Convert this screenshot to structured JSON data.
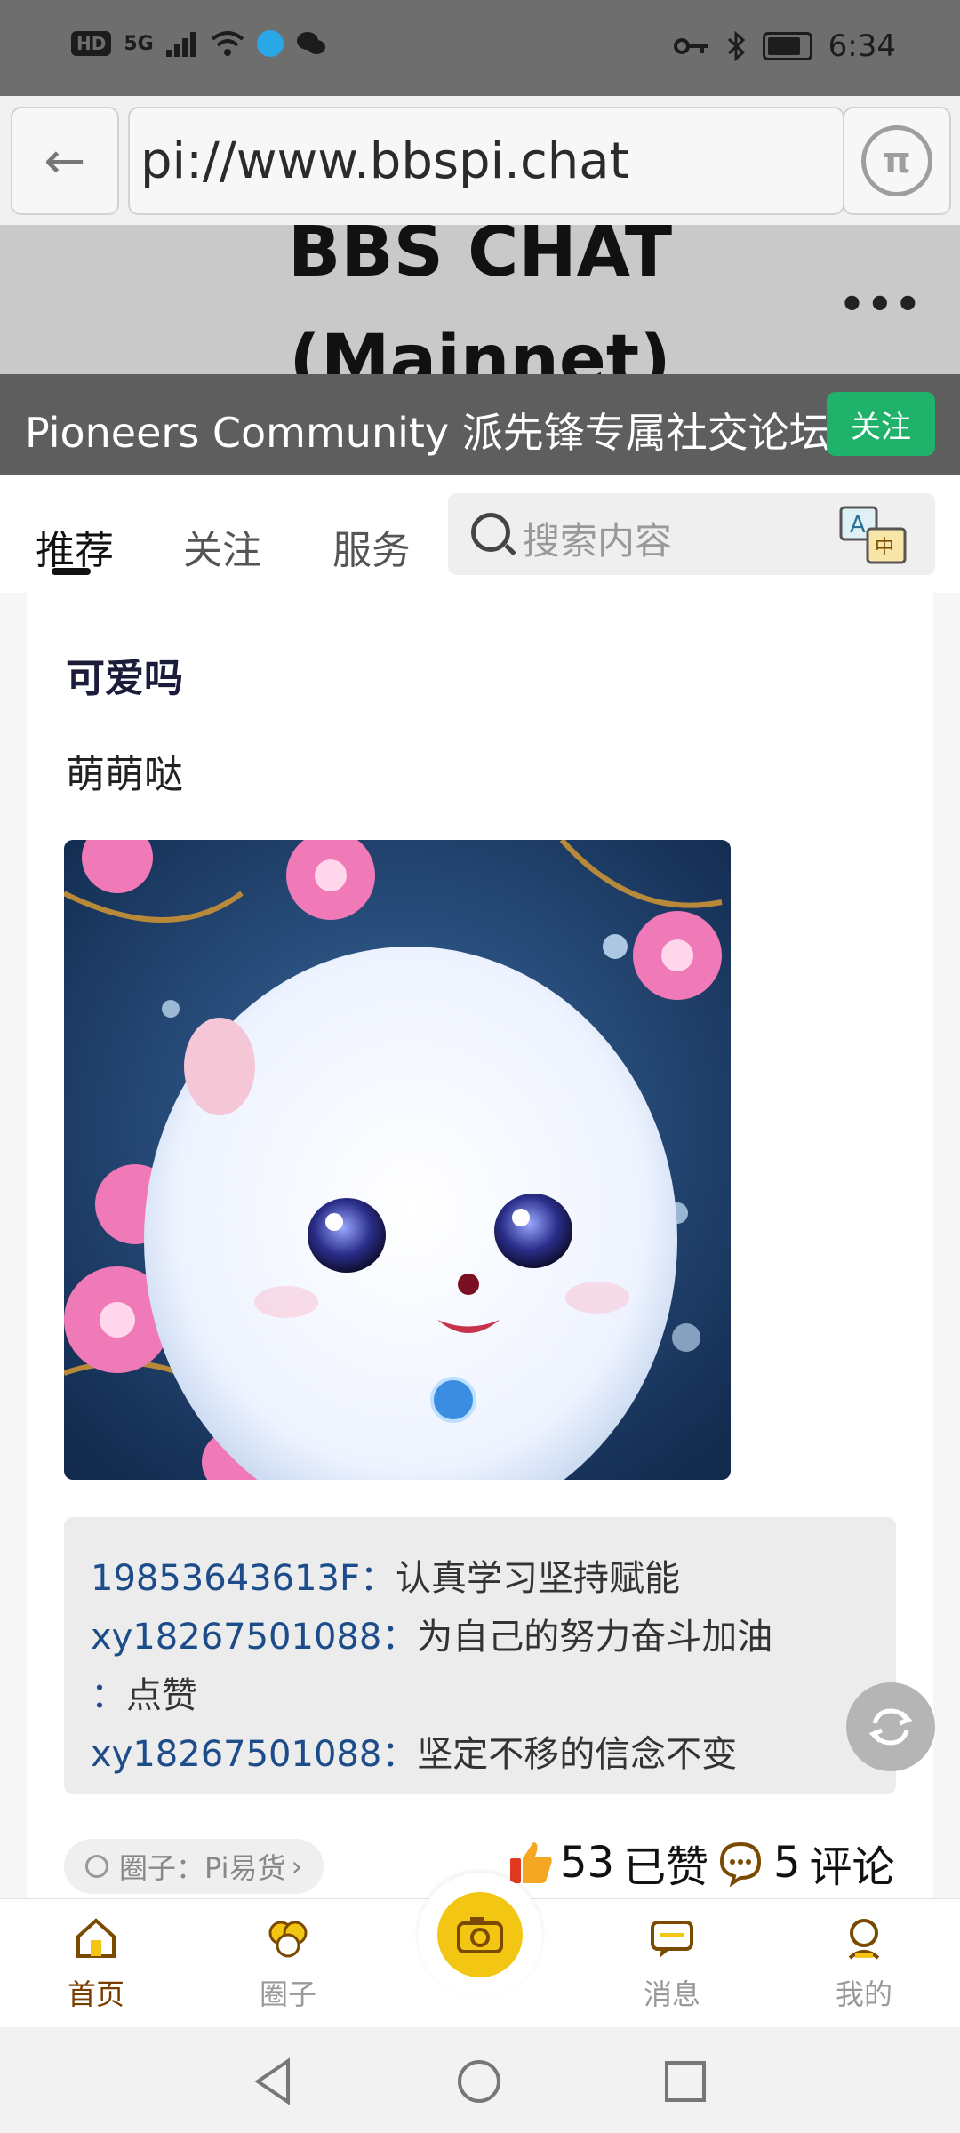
{
  "status_bar": {
    "left_icons": [
      "HD",
      "5G"
    ],
    "time": "6:34"
  },
  "browser": {
    "url": "pi://www.bbspi.chat",
    "back_glyph": "←",
    "pi_glyph": "π"
  },
  "site": {
    "title": "BBS CHAT\n(Mainnet)",
    "community": "Pioneers Community 派先锋专属社交论坛",
    "follow_label": "关注",
    "more_glyph": "•••"
  },
  "tabs": {
    "items": [
      "推荐",
      "关注",
      "服务"
    ],
    "search_placeholder": "搜索内容"
  },
  "post": {
    "title": "可爱吗",
    "body": "萌萌哒",
    "comments": [
      {
        "user": "19853643613F：",
        "text": "认真学习坚持赋能"
      },
      {
        "user": "xy18267501088：",
        "text": "为自己的努力奋斗加油"
      },
      {
        "user": "：",
        "text": "点赞"
      },
      {
        "user": "xy18267501088：",
        "text": "坚定不移的信念不变"
      }
    ],
    "circle_tag": "圈子：Pi易货",
    "likes": "53",
    "likes_label": "已赞",
    "comment_count": "5",
    "comment_label": "评论"
  },
  "bottom_nav": [
    {
      "label": "首页"
    },
    {
      "label": "圈子"
    },
    {
      "label": "消息"
    },
    {
      "label": "我的"
    }
  ],
  "colors": {
    "accent_green": "#1eb26a",
    "accent_yellow": "#f3c613",
    "link_blue": "#1d4c8a"
  },
  "icons": [
    "back-arrow-icon",
    "pi-icon",
    "more-icon",
    "search-icon",
    "translate-icon",
    "refresh-icon",
    "home-icon",
    "circle-icon",
    "camera-icon",
    "message-icon",
    "profile-icon",
    "thumb-up-icon",
    "comment-icon"
  ]
}
